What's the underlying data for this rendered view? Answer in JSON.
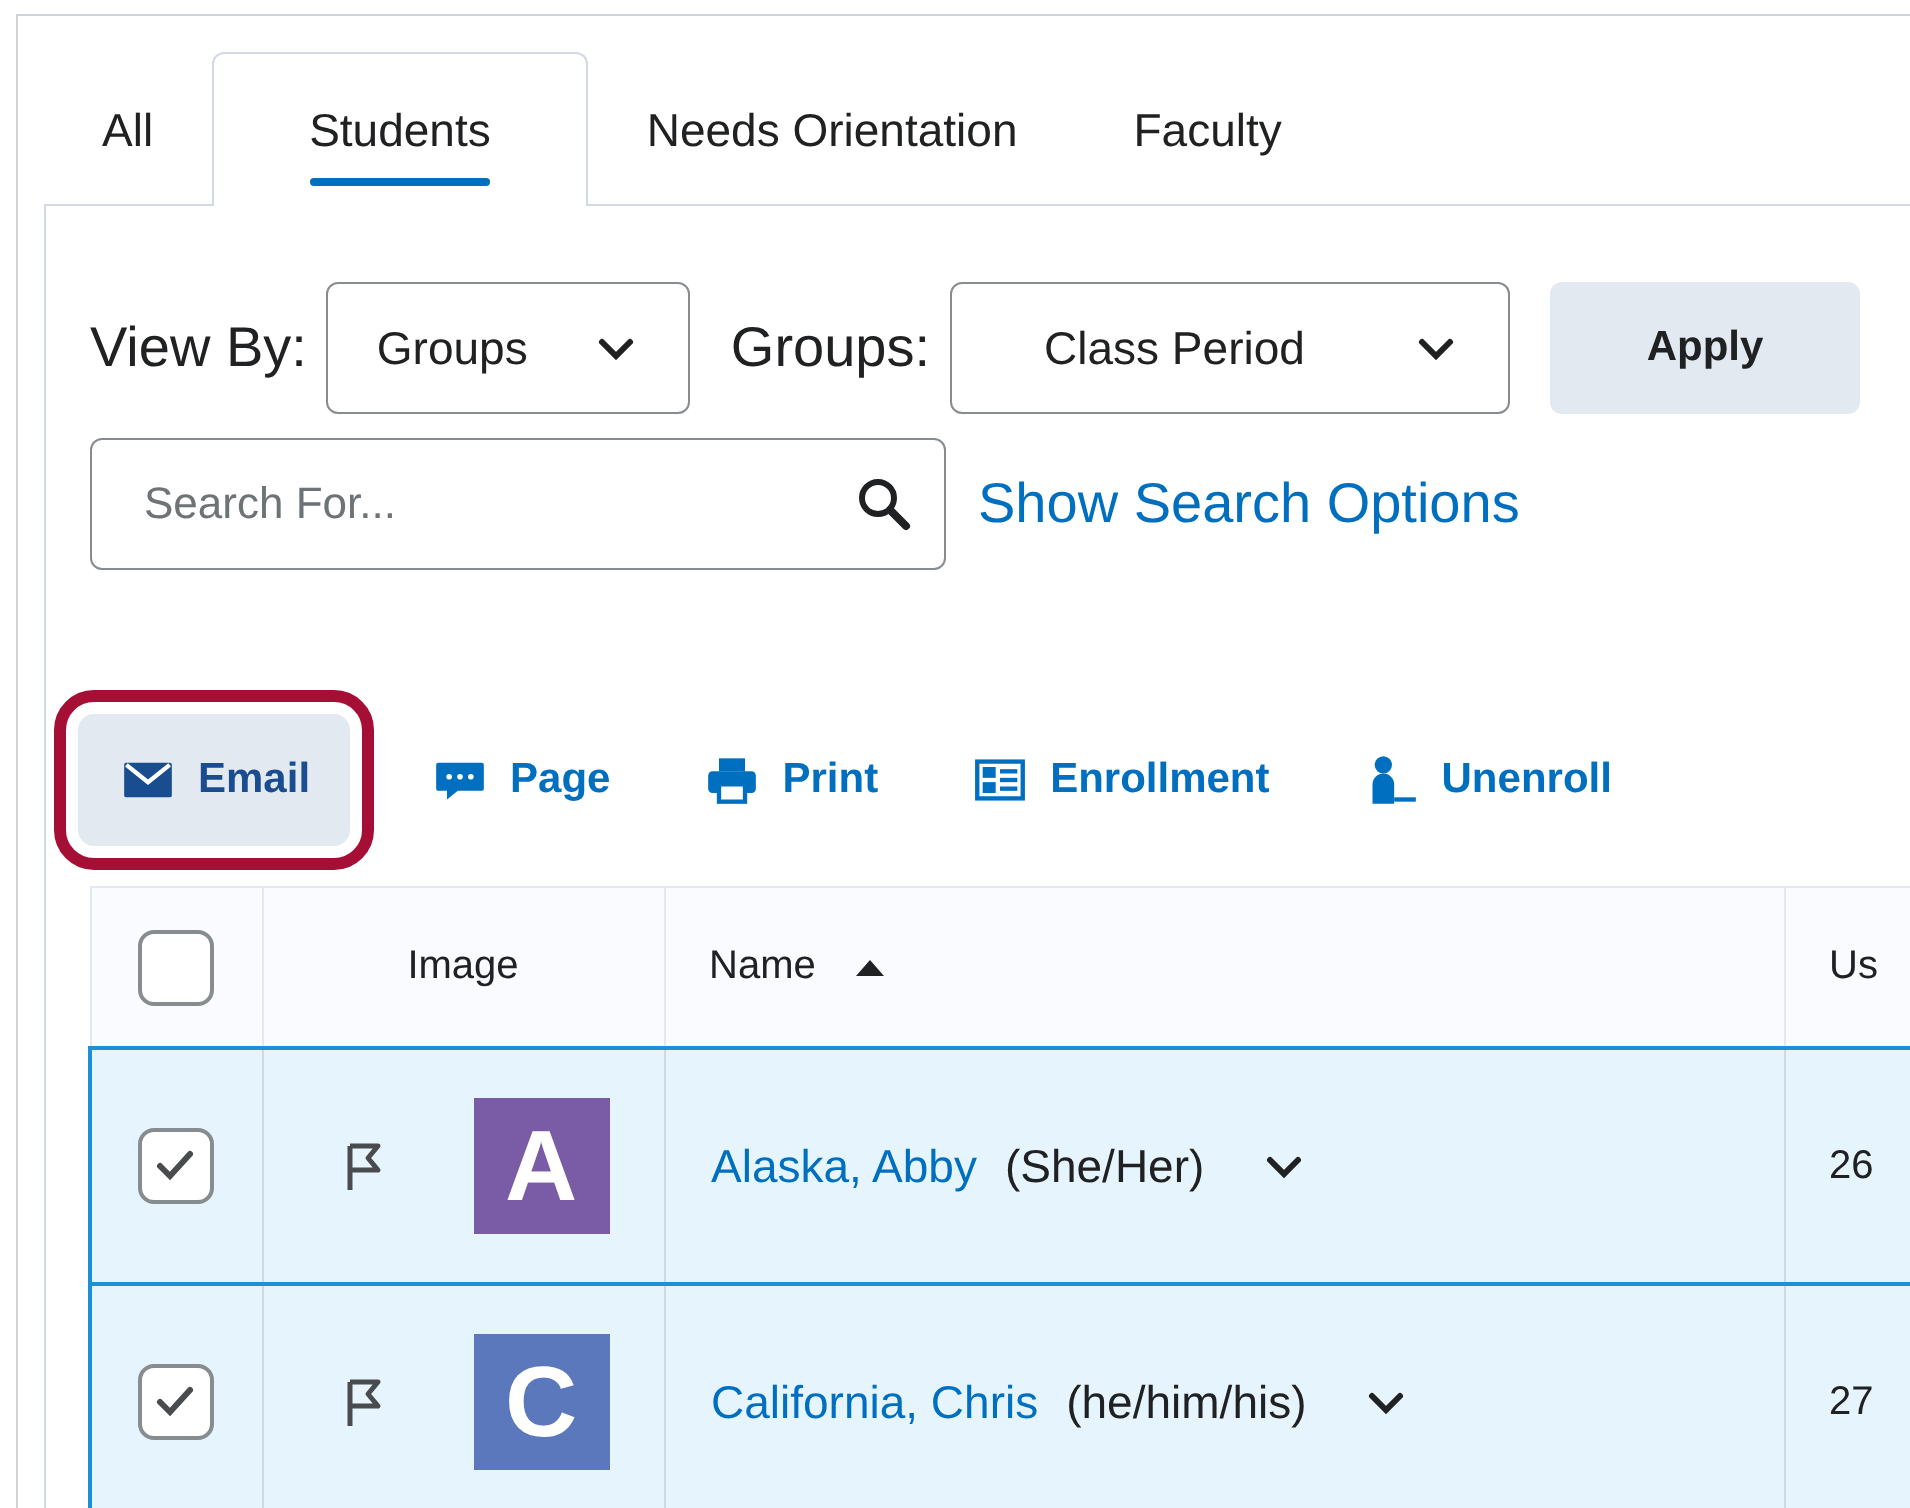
{
  "tabs": [
    {
      "label": "All",
      "selected": false
    },
    {
      "label": "Students",
      "selected": true
    },
    {
      "label": "Needs Orientation",
      "selected": false
    },
    {
      "label": "Faculty",
      "selected": false
    }
  ],
  "filters": {
    "view_by_label": "View By:",
    "view_by_value": "Groups",
    "groups_label": "Groups:",
    "groups_value": "Class Period",
    "apply": "Apply"
  },
  "search": {
    "placeholder": "Search For...",
    "options_link": "Show Search Options"
  },
  "toolbar": [
    {
      "label": "Email",
      "highlighted": true
    },
    {
      "label": "Page",
      "highlighted": false
    },
    {
      "label": "Print",
      "highlighted": false
    },
    {
      "label": "Enrollment",
      "highlighted": false
    },
    {
      "label": "Unenroll",
      "highlighted": false
    }
  ],
  "table": {
    "select_all_checked": false,
    "columns": [
      "Image",
      "Name",
      "Us"
    ],
    "rows": [
      {
        "checked": true,
        "avatar_letter": "A",
        "color": "#7a5ca6",
        "name": "Alaska, Abby",
        "pronouns": "(She/Her)",
        "column_3": "26"
      },
      {
        "checked": true,
        "avatar_letter": "C",
        "color": "#5b78bd",
        "name": "California, Chris",
        "pronouns": "(he/him/his)",
        "column_3": "27"
      }
    ]
  }
}
